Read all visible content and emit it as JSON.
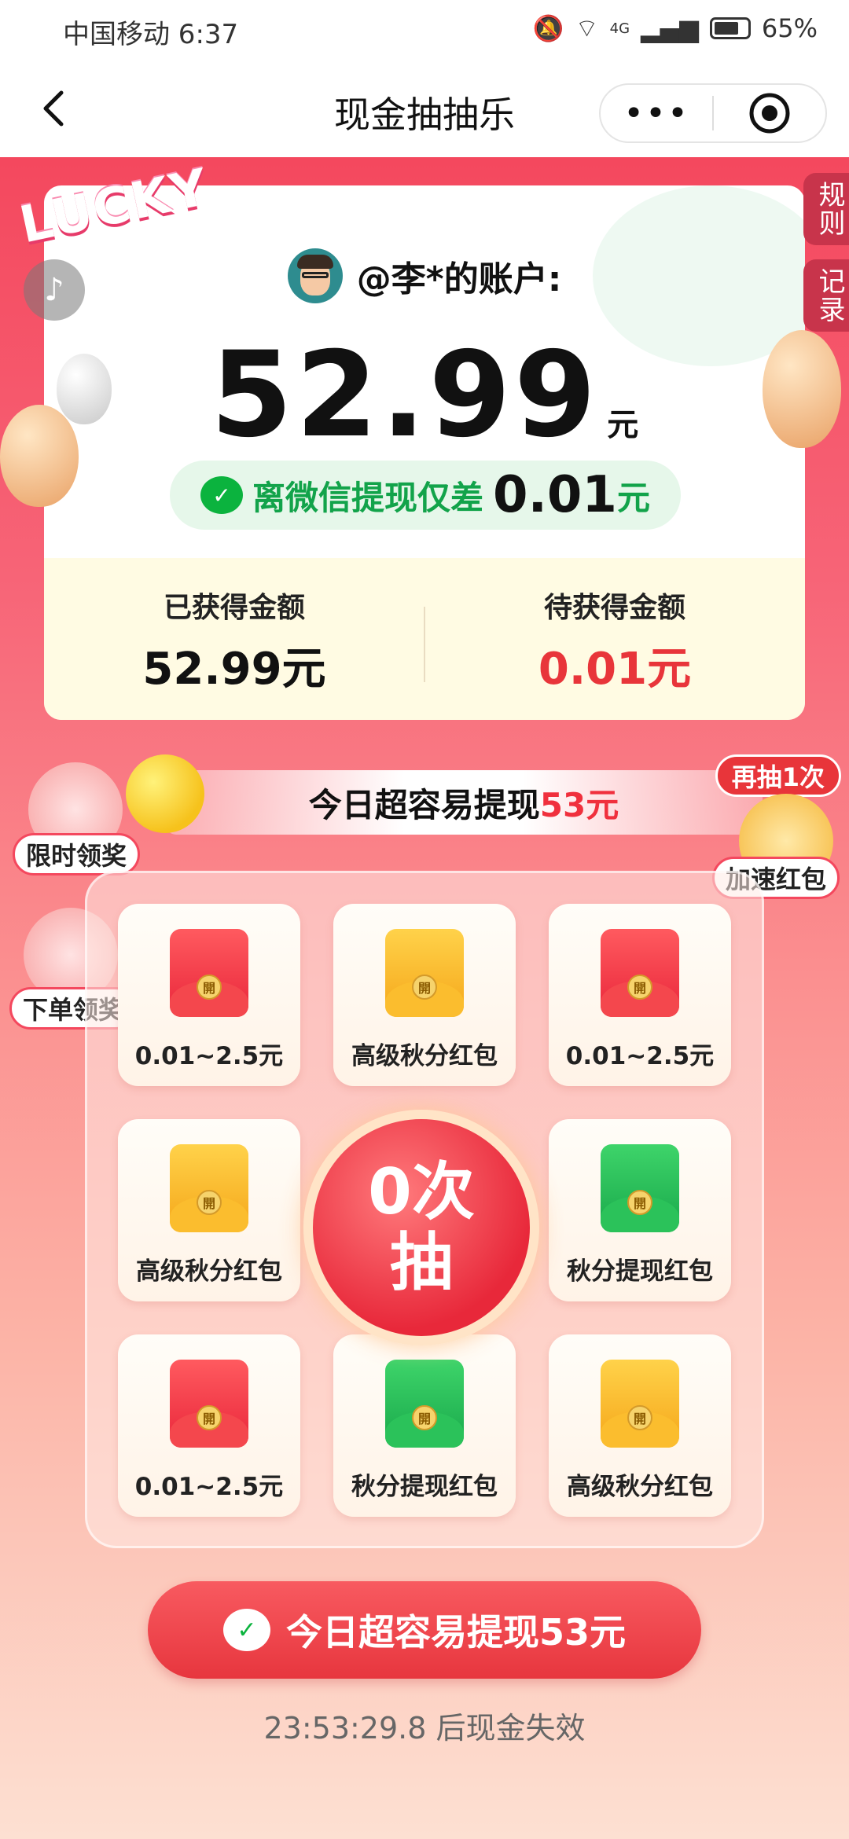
{
  "status_bar": {
    "carrier_time": "中国移动 6:37",
    "signal": "4G",
    "battery": "65%"
  },
  "nav": {
    "title": "现金抽抽乐",
    "more": "•••"
  },
  "badge": "LUCKY",
  "side_tabs": {
    "rules": "规则",
    "records": "记录"
  },
  "account": {
    "name": "@李*的账户:",
    "amount": "52.99",
    "unit": "元",
    "gap_prefix": "离微信提现仅差",
    "gap_value": "0.01",
    "gap_unit": "元",
    "earned_label": "已获得金额",
    "earned_value": "52.99元",
    "pending_label": "待获得金额",
    "pending_value": "0.01元"
  },
  "banner": {
    "text": "今日超容易提现",
    "highlight": "53元"
  },
  "side_buttons": {
    "limited": "限时领奖",
    "order": "下单领奖",
    "again": "再抽1次",
    "speed": "加速红包"
  },
  "grid": [
    {
      "label": "0.01~2.5元",
      "color": "red"
    },
    {
      "label": "高级秋分红包",
      "color": "gold"
    },
    {
      "label": "0.01~2.5元",
      "color": "red"
    },
    {
      "label": "高级秋分红包",
      "color": "gold"
    },
    {
      "label": "秋分提现红包",
      "color": "green"
    },
    {
      "label": "0.01~2.5元",
      "color": "red"
    },
    {
      "label": "秋分提现红包",
      "color": "green"
    },
    {
      "label": "高级秋分红包",
      "color": "gold"
    }
  ],
  "seal_char": "開",
  "draw": {
    "line1": "0次",
    "line2": "抽"
  },
  "withdraw_button": "今日超容易提现53元",
  "countdown": "23:53:29.8 后现金失效",
  "colors": {
    "primary": "#f4485e",
    "accent_red": "#e8353a",
    "wechat_green": "#0bb33e"
  }
}
